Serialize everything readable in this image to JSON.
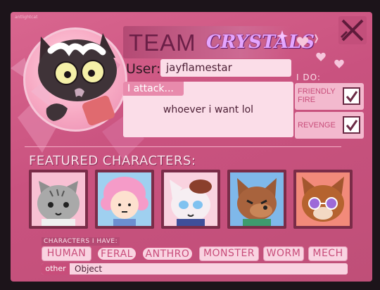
{
  "watermark": "antlightcat",
  "header": {
    "team_word": "TEAM",
    "team_name": "CRYSTALS"
  },
  "user": {
    "label": "User:",
    "value": "jayflamestar"
  },
  "attack": {
    "label": "I attack...",
    "value": "whoever i want lol"
  },
  "i_do": {
    "label": "I DO:",
    "options": [
      {
        "label_line1": "FRIENDLY",
        "label_line2": "FIRE",
        "checked": true
      },
      {
        "label_line1": "REVENGE",
        "label_line2": "",
        "checked": true
      }
    ]
  },
  "featured": {
    "title": "FEATURED CHARACTERS:",
    "characters": [
      {
        "icon": "gray-tabby-cat-portrait"
      },
      {
        "icon": "pink-haired-person-portrait"
      },
      {
        "icon": "blue-eyed-white-cat-portrait"
      },
      {
        "icon": "brown-wolf-portrait"
      },
      {
        "icon": "brown-cat-with-sunglasses-portrait"
      }
    ]
  },
  "species": {
    "title": "CHARACTERS I HAVE:",
    "tags": [
      {
        "label": "HUMAN",
        "circled": false
      },
      {
        "label": "FERAL",
        "circled": true
      },
      {
        "label": "ANTHRO",
        "circled": true
      },
      {
        "label": "MONSTER",
        "circled": false
      },
      {
        "label": "WORM",
        "circled": false
      },
      {
        "label": "MECH",
        "circled": false
      }
    ],
    "other_label": "other",
    "other_value": "Object"
  },
  "colors": {
    "card": "#c9527f",
    "field": "#fbdde8",
    "accent": "#c84d7a",
    "dark": "#1c141a"
  },
  "icons": [
    "black-cat-avatar",
    "crossed-sword-icon",
    "heart-icon",
    "sparkle-icon"
  ]
}
